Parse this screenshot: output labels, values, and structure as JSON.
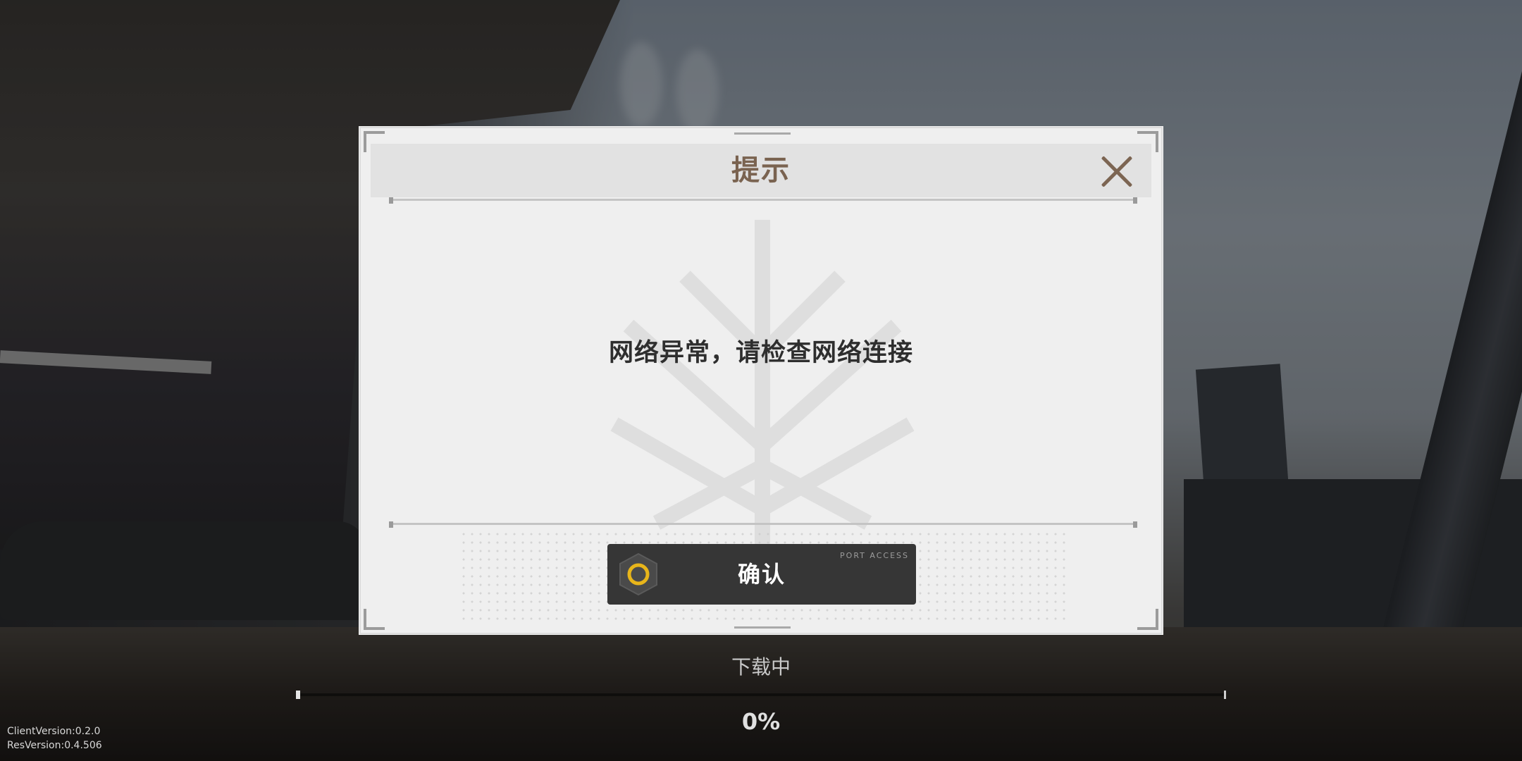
{
  "dialog": {
    "title": "提示",
    "message": "网络异常，请检查网络连接",
    "confirm_label": "确认",
    "confirm_tag": "PORT ACCESS",
    "close_icon": "close-icon"
  },
  "loading": {
    "status": "下载中",
    "percent_text": "0%",
    "progress": 0
  },
  "versions": {
    "client": "ClientVersion:0.2.0",
    "res": "ResVersion:0.4.506"
  },
  "colors": {
    "title": "#7a6350",
    "button_bg": "#363636",
    "button_ring": "#e8b51a"
  }
}
